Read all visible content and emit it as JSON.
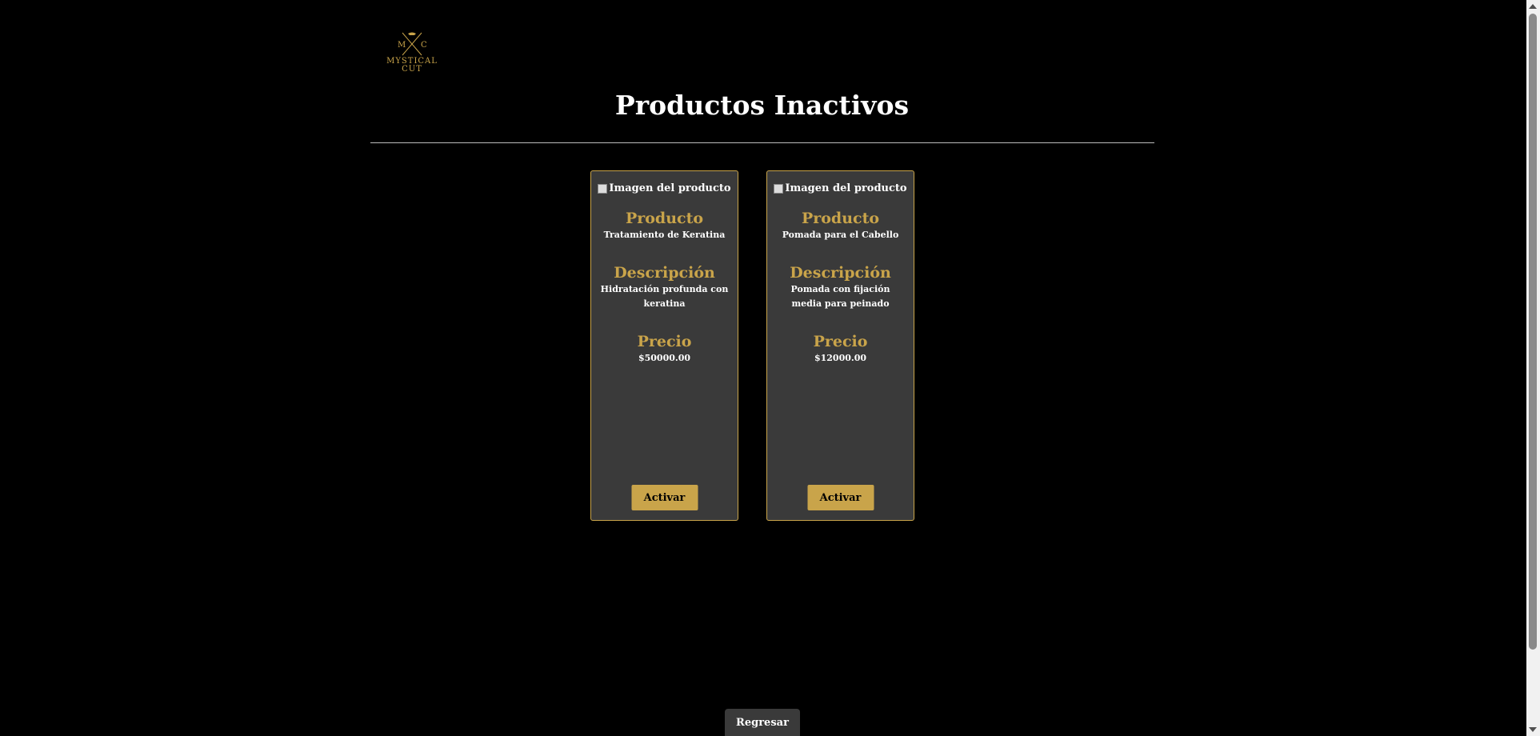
{
  "header": {
    "logo_letters_left": "M",
    "logo_letters_right": "C",
    "logo_line1": "MYSTICAL",
    "logo_line2": "CUT",
    "title": "Productos Inactivos"
  },
  "labels": {
    "image_alt": "Imagen del producto",
    "product": "Producto",
    "description": "Descripción",
    "price": "Precio",
    "activate": "Activar"
  },
  "products": [
    {
      "name": "Tratamiento de Keratina",
      "description": "Hidratación profunda con keratina",
      "price": "$50000.00"
    },
    {
      "name": "Pomada para el Cabello",
      "description": "Pomada con fijación media para peinado",
      "price": "$12000.00"
    }
  ],
  "footer": {
    "back_label": "Regresar"
  },
  "colors": {
    "accent": "#c9a44a",
    "card_bg": "#3a3a3a",
    "page_bg": "#000000"
  }
}
